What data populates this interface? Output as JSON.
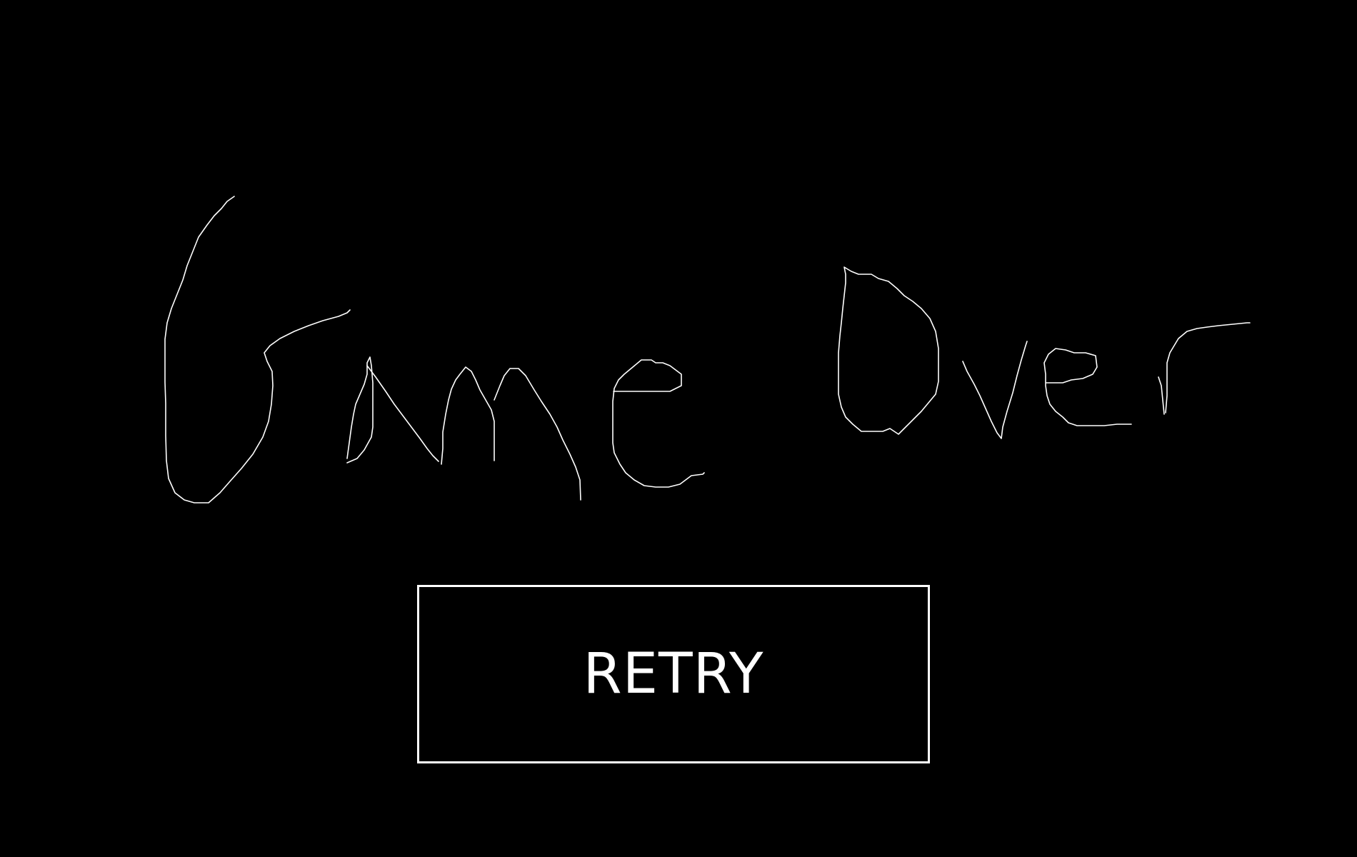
{
  "screen": {
    "title_text": "Game Over",
    "background_color": "#000000",
    "foreground_color": "#ffffff"
  },
  "retry_button": {
    "label": "RETRY"
  }
}
